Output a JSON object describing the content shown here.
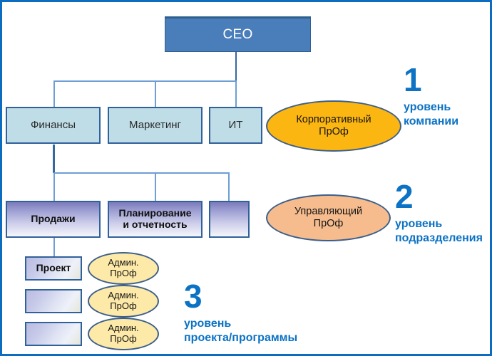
{
  "diagram": {
    "title_node": {
      "label": "CEO"
    },
    "level1_departments": [
      {
        "label": "Финансы"
      },
      {
        "label": "Маркетинг"
      },
      {
        "label": "ИТ"
      }
    ],
    "level2_units": [
      {
        "label": "Продажи"
      },
      {
        "label": "Планирование\nи отчетность"
      },
      {
        "label": ""
      }
    ],
    "level3_projects": [
      {
        "label": "Проект"
      },
      {
        "label": ""
      },
      {
        "label": ""
      }
    ],
    "role_ellipses": {
      "corporate": {
        "label": "Корпоративный\nПрОф",
        "color": "#fcb611"
      },
      "manager": {
        "label": "Управляющий\nПрОф",
        "color": "#f6bc8e"
      },
      "admins": [
        {
          "label": "Админ.\nПрОф",
          "color": "#fde9a8"
        },
        {
          "label": "Админ.\nПрОф",
          "color": "#fde9a8"
        },
        {
          "label": "Админ.\nПрОф",
          "color": "#fde9a8"
        }
      ]
    },
    "level_callouts": [
      {
        "number": "1",
        "caption": "уровень\nкомпании"
      },
      {
        "number": "2",
        "caption": "уровень\nподразделения"
      },
      {
        "number": "3",
        "caption": "уровень\nпроекта/программы"
      }
    ],
    "colors": {
      "frame_border": "#0b6cc0",
      "ceo_fill": "#4a7ebb",
      "department_fill": "#bfdde7",
      "node_border": "#31619a",
      "callout_text": "#0b72c4",
      "connector": "#6e9ed4"
    }
  }
}
